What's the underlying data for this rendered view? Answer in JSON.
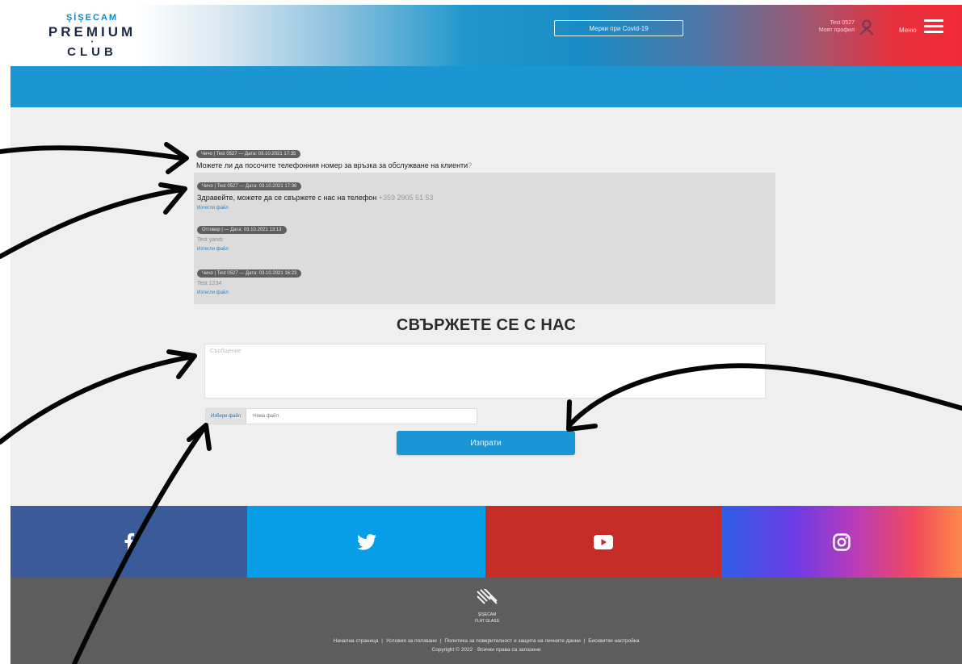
{
  "header": {
    "brand": "ŞİŞECAM",
    "logo_premium": "PREMIUM",
    "logo_club": "CLUB",
    "covid_button": "Мерки при Covid-19",
    "user_name": "Test 0527",
    "user_sub": "Моят профил",
    "menu_label": "Меню"
  },
  "conversation": {
    "question": {
      "tag": "Чичо | Test 0527 — Дата: 03.10.2021 17:35",
      "text": "Можете ли да посочите телефонния номер за връзка за обслужване на клиенти",
      "suffix": "?"
    },
    "replies": [
      {
        "tag": "Чичо | Test 0527 — Дата: 03.10.2021 17:36",
        "text": "Здравейте, можете да се свържете с нас на телефон",
        "phone": "+359 2905 51 53",
        "download": "Изтегли файл"
      },
      {
        "tag": "Отговор | — Дата: 03.10.2021 13:13",
        "text": "Test yanıtı",
        "download": "Изтегли файл"
      },
      {
        "tag": "Чичо | Test 0527 — Дата: 03.10.2021 16:23",
        "text": "Test 1234",
        "download": "Изтегли файл"
      }
    ]
  },
  "contact": {
    "title": "СВЪРЖЕТЕ СЕ С НАС",
    "message_placeholder": "Съобщение",
    "choose_file_label": "Избери файл",
    "no_file_label": "Няма файл",
    "send_label": "Изпрати"
  },
  "social": {
    "items": [
      {
        "name": "facebook",
        "color": "#3a5a9a"
      },
      {
        "name": "twitter",
        "color": "#079ee7"
      },
      {
        "name": "youtube",
        "color": "#c62c26"
      },
      {
        "name": "instagram",
        "color": "#d33d9a"
      }
    ]
  },
  "footer": {
    "brand_line1": "ŞİŞECAM",
    "brand_line2": "FLAT GLASS",
    "links": [
      "Начална страница",
      "Условия за ползване",
      "Политика за поверителност и защита на личните данни",
      "Бисквитки настройка"
    ],
    "copyright": "Copyright © 2022 · Всички права са запазени"
  },
  "colors": {
    "primary_blue": "#1b96d2",
    "main_bg": "#efefef",
    "footer_bg": "#5d5d5d"
  }
}
